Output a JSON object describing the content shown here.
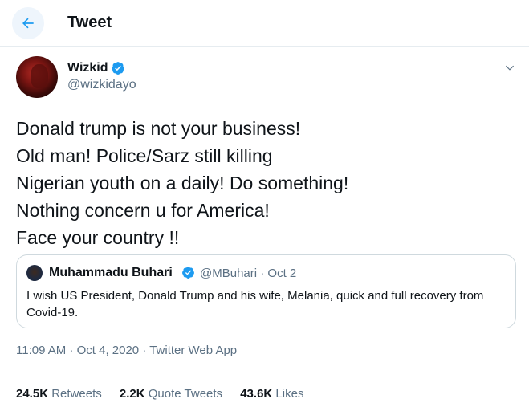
{
  "header": {
    "title": "Tweet"
  },
  "tweet": {
    "author": {
      "name": "Wizkid",
      "handle": "@wizkidayo",
      "verified": true
    },
    "lines": [
      "Donald trump is not your business!",
      "Old man! Police/Sarz still killing",
      "Nigerian youth on a daily! Do something!",
      "Nothing concern u for America!",
      "Face your country !!"
    ],
    "quote": {
      "name": "Muhammadu Buhari",
      "handle": "@MBuhari · Oct 2",
      "text": "I wish US President, Donald Trump and his wife, Melania, quick and full recovery from Covid-19."
    },
    "meta": "11:09 AM · Oct 4, 2020 · Twitter Web App",
    "stats": {
      "retweets": {
        "count": "24.5K",
        "label": "Retweets"
      },
      "quotes": {
        "count": "2.2K",
        "label": "Quote Tweets"
      },
      "likes": {
        "count": "43.6K",
        "label": "Likes"
      }
    }
  },
  "colors": {
    "accent": "#1d9bf0",
    "muted": "#5b7083",
    "text": "#0f1419"
  },
  "icons": [
    "back-arrow-icon",
    "verified-badge-icon",
    "chevron-down-icon"
  ]
}
